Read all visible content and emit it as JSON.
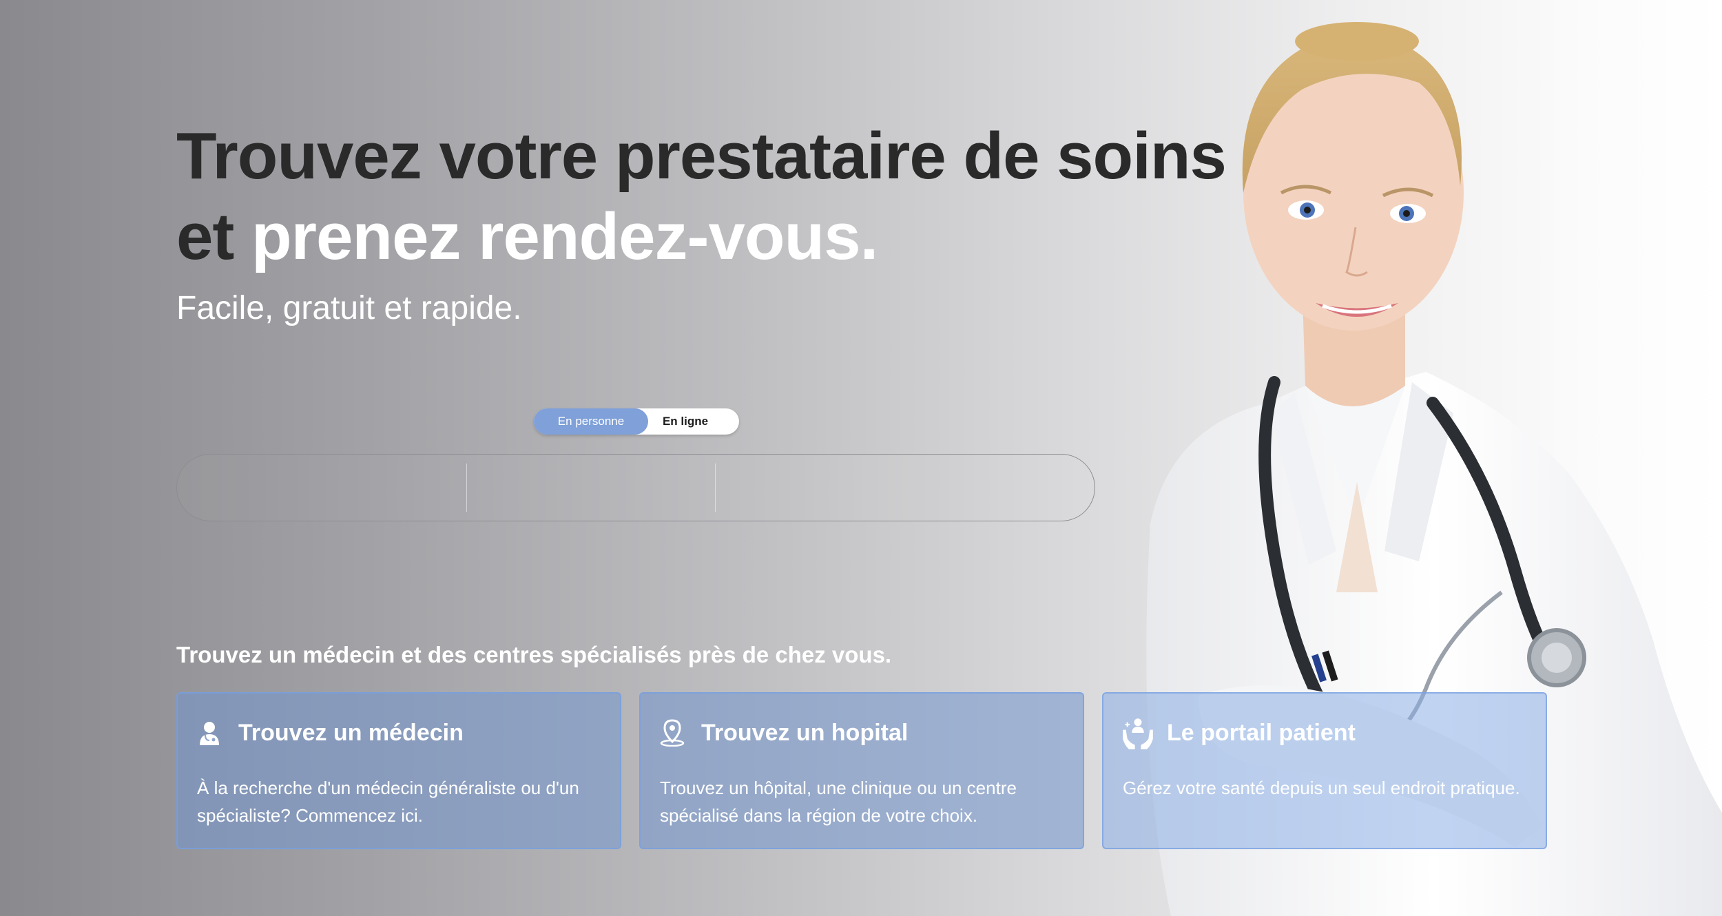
{
  "hero": {
    "headline_line1": "Trouvez votre prestataire de soins",
    "headline_line2_dark": "et ",
    "headline_line2_light": "prenez rendez-vous.",
    "subheadline": "Facile, gratuit et rapide."
  },
  "mode_toggle": {
    "options": [
      {
        "label": "En personne",
        "selected": true
      },
      {
        "label": "En ligne",
        "selected": false
      }
    ]
  },
  "search": {
    "fields": [
      "",
      "",
      ""
    ]
  },
  "services": {
    "section_title": "Trouvez un médecin et des centres spécialisés près de chez vous.",
    "cards": [
      {
        "icon": "doctor-icon",
        "title": "Trouvez un médecin",
        "description": "À la recherche d'un médecin généraliste ou d'un spécialiste? Commencez ici."
      },
      {
        "icon": "location-pin-icon",
        "title": "Trouvez un hopital",
        "description": "Trouvez un hôpital, une clinique ou un centre spécialisé dans la région de votre choix."
      },
      {
        "icon": "care-hands-icon",
        "title": "Le portail patient",
        "description": "Gérez votre santé depuis un seul endroit pratique."
      }
    ]
  },
  "colors": {
    "accent": "#7fa0d8",
    "headline_dark": "#2a2a2a",
    "card_fill": "#7396cd"
  }
}
